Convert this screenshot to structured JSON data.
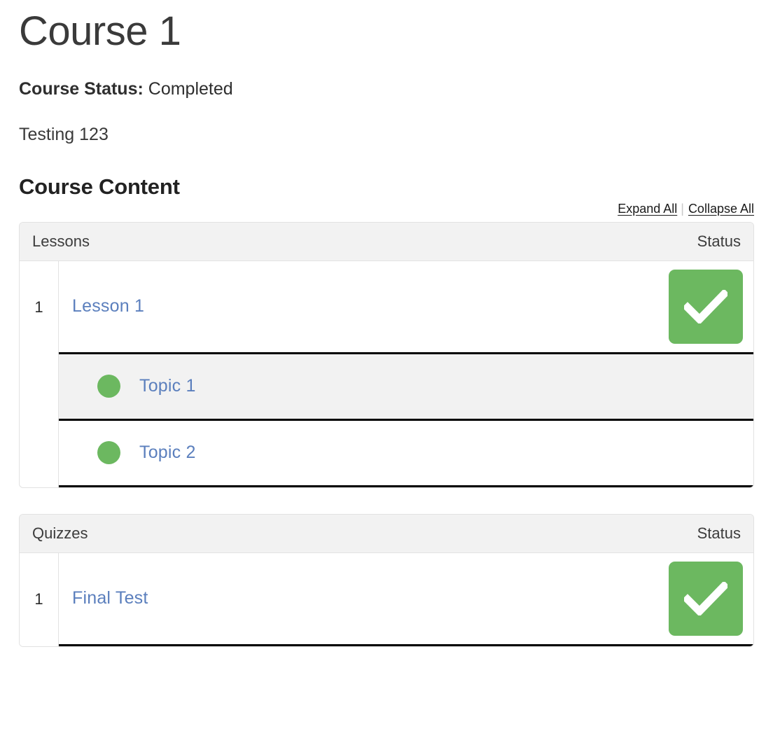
{
  "course": {
    "title": "Course 1",
    "status_label": "Course Status:",
    "status_value": "Completed",
    "description": "Testing 123"
  },
  "content_section": {
    "heading": "Course Content",
    "expand_all": "Expand All",
    "collapse_all": "Collapse All",
    "separator": "|"
  },
  "colors": {
    "status_complete": "#6cb860",
    "link": "#5b7fbd",
    "header_bg": "#f2f2f2",
    "row_alt_bg": "#f2f2f2",
    "row_border": "#000000"
  },
  "lessons_table": {
    "header_label": "Lessons",
    "header_status": "Status",
    "rows": [
      {
        "number": "1",
        "title": "Lesson 1",
        "status_icon": "check-complete-icon",
        "topics": [
          {
            "title": "Topic 1",
            "status_icon": "dot-complete-icon",
            "shaded": true
          },
          {
            "title": "Topic 2",
            "status_icon": "dot-complete-icon",
            "shaded": false
          }
        ]
      }
    ]
  },
  "quizzes_table": {
    "header_label": "Quizzes",
    "header_status": "Status",
    "rows": [
      {
        "number": "1",
        "title": "Final Test",
        "status_icon": "check-complete-icon"
      }
    ]
  }
}
